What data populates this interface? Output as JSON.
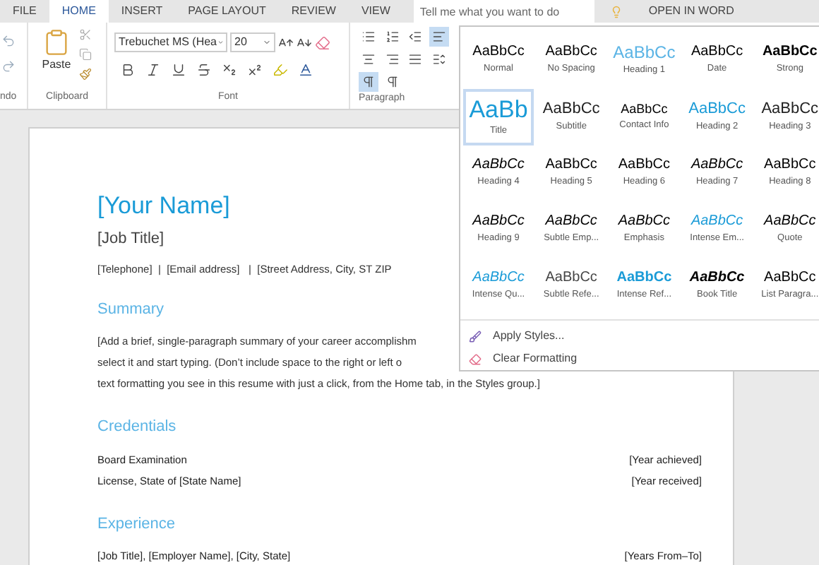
{
  "tabs": [
    {
      "label": "FILE",
      "selected": false
    },
    {
      "label": "HOME",
      "selected": true
    },
    {
      "label": "INSERT",
      "selected": false
    },
    {
      "label": "PAGE LAYOUT",
      "selected": false
    },
    {
      "label": "REVIEW",
      "selected": false
    },
    {
      "label": "VIEW",
      "selected": false
    }
  ],
  "search": {
    "placeholder": "Tell me what you want to do"
  },
  "open_in_word": "OPEN IN WORD",
  "ribbon": {
    "undo_label": "ndo",
    "clipboard": {
      "paste": "Paste",
      "label": "Clipboard"
    },
    "font": {
      "name": "Trebuchet MS (Hea",
      "size": "20",
      "label": "Font"
    },
    "paragraph": {
      "label": "Paragraph",
      "buttons": [
        {
          "kind": "bullets",
          "selected": false
        },
        {
          "kind": "numbering",
          "selected": false
        },
        {
          "kind": "outdent",
          "selected": false
        },
        {
          "kind": "left",
          "selected": true
        },
        {
          "kind": "center",
          "selected": false
        },
        {
          "kind": "right",
          "selected": false
        },
        {
          "kind": "justify",
          "selected": false
        },
        {
          "kind": "spacing",
          "selected": false
        },
        {
          "kind": "ltr",
          "selected": true
        },
        {
          "kind": "rtl",
          "selected": false
        }
      ]
    }
  },
  "document": {
    "name": "[Your Name]",
    "job_title": "[Job Title]",
    "contact": "[Telephone]  |  [Email address]   |  [Street Address, City, ST ZIP",
    "sections": [
      {
        "kind": "paragraph",
        "heading": "Summary",
        "lines": [
          "[Add a brief, single-paragraph summary of your career accomplishm",
          "select it and start typing. (Don’t include space to the right or left o",
          "text formatting you see in this resume with just a click, from the Home tab, in the Styles group.]"
        ]
      },
      {
        "kind": "rows",
        "heading": "Credentials",
        "rows": [
          {
            "left": "Board Examination",
            "right": "[Year achieved]"
          },
          {
            "left": "License, State of [State Name]",
            "right": "[Year received]"
          }
        ]
      },
      {
        "kind": "rows",
        "heading": "Experience",
        "rows": [
          {
            "left": "[Job Title], [Employer Name], [City, State]",
            "right": "[Years From–To]"
          }
        ]
      }
    ]
  },
  "styles_menu": {
    "styles": [
      {
        "sample": "AaBbCc",
        "label": "Normal",
        "kind": "plain",
        "selected": false
      },
      {
        "sample": "AaBbCc",
        "label": "No Spacing",
        "kind": "plain",
        "selected": false
      },
      {
        "sample": "AaBbCc",
        "label": "Heading 1",
        "kind": "lightblue",
        "selected": false
      },
      {
        "sample": "AaBbCc",
        "label": "Date",
        "kind": "plain",
        "selected": false
      },
      {
        "sample": "AaBbCc",
        "label": "Strong",
        "kind": "bold",
        "selected": false
      },
      {
        "sample": "AaBb",
        "label": "Title",
        "kind": "title",
        "selected": true
      },
      {
        "sample": "AaBbCc",
        "label": "Subtitle",
        "kind": "large",
        "selected": false
      },
      {
        "sample": "AaBbCc",
        "label": "Contact Info",
        "kind": "small",
        "selected": false
      },
      {
        "sample": "AaBbCc",
        "label": "Heading 2",
        "kind": "blue",
        "selected": false
      },
      {
        "sample": "AaBbCc",
        "label": "Heading 3",
        "kind": "large",
        "selected": false
      },
      {
        "sample": "AaBbCc",
        "label": "Heading 4",
        "kind": "italic",
        "selected": false
      },
      {
        "sample": "AaBbCc",
        "label": "Heading 5",
        "kind": "plain",
        "selected": false
      },
      {
        "sample": "AaBbCc",
        "label": "Heading 6",
        "kind": "plain",
        "selected": false
      },
      {
        "sample": "AaBbCc",
        "label": "Heading 7",
        "kind": "italic",
        "selected": false
      },
      {
        "sample": "AaBbCc",
        "label": "Heading 8",
        "kind": "plain",
        "selected": false
      },
      {
        "sample": "AaBbCc",
        "label": "Heading 9",
        "kind": "italic",
        "selected": false
      },
      {
        "sample": "AaBbCc",
        "label": "Subtle Emp...",
        "kind": "italic",
        "selected": false
      },
      {
        "sample": "AaBbCc",
        "label": "Emphasis",
        "kind": "italic",
        "selected": false
      },
      {
        "sample": "AaBbCc",
        "label": "Intense Em...",
        "kind": "blueitalic",
        "selected": false
      },
      {
        "sample": "AaBbCc",
        "label": "Quote",
        "kind": "italic",
        "selected": false
      },
      {
        "sample": "AaBbCc",
        "label": "Intense Qu...",
        "kind": "blueitalic",
        "selected": false
      },
      {
        "sample": "AaBbCc",
        "label": "Subtle Refe...",
        "kind": "grey",
        "selected": false
      },
      {
        "sample": "AaBbCc",
        "label": "Intense Ref...",
        "kind": "boldblue",
        "selected": false
      },
      {
        "sample": "AaBbCc",
        "label": "Book Title",
        "kind": "bolditalic",
        "selected": false
      },
      {
        "sample": "AaBbCc",
        "label": "List Paragra...",
        "kind": "plain",
        "selected": false
      }
    ],
    "actions": [
      {
        "kind": "apply",
        "label": "Apply Styles..."
      },
      {
        "kind": "clear",
        "label": "Clear Formatting"
      }
    ]
  }
}
